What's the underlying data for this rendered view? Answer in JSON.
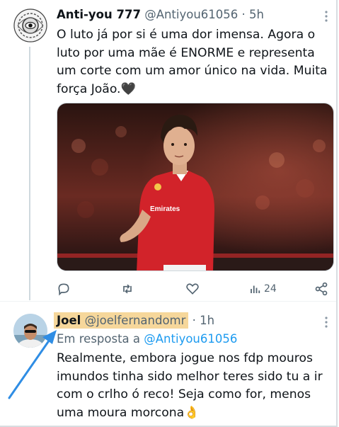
{
  "tweet1": {
    "name": "Anti-you 777",
    "handle": "@Antiyou61056",
    "separator": "·",
    "time": "5h",
    "text_lines": [
      "O luto já por si é uma dor imensa. Agora o",
      "luto por uma mãe é ENORME e representa",
      "um corte com um amor único na vida. Muita",
      "força João.🖤"
    ],
    "views": "24",
    "photo_jersey_text": "Emirates"
  },
  "tweet2": {
    "name": "Joel",
    "handle": "@joelfernandomr",
    "separator": "·",
    "time": "1h",
    "reply_prefix": "Em resposta a",
    "reply_handle": "@Antiyou61056",
    "text_lines": [
      "Realmente, embora jogue nos fdp mouros",
      "imundos tinha sido melhor teres sido tu a ir",
      "com o crlho ó reco! Seja como for, menos",
      "uma moura morcona👌"
    ]
  },
  "icons": [
    "reply-icon",
    "retweet-icon",
    "like-icon",
    "views-icon",
    "share-icon",
    "more-icon",
    "arrow-annotation-icon"
  ],
  "colors": {
    "highlight": "#f6d79b",
    "link": "#1d9bf0",
    "arrow": "#2f8de4",
    "jersey": "#d2232a"
  }
}
